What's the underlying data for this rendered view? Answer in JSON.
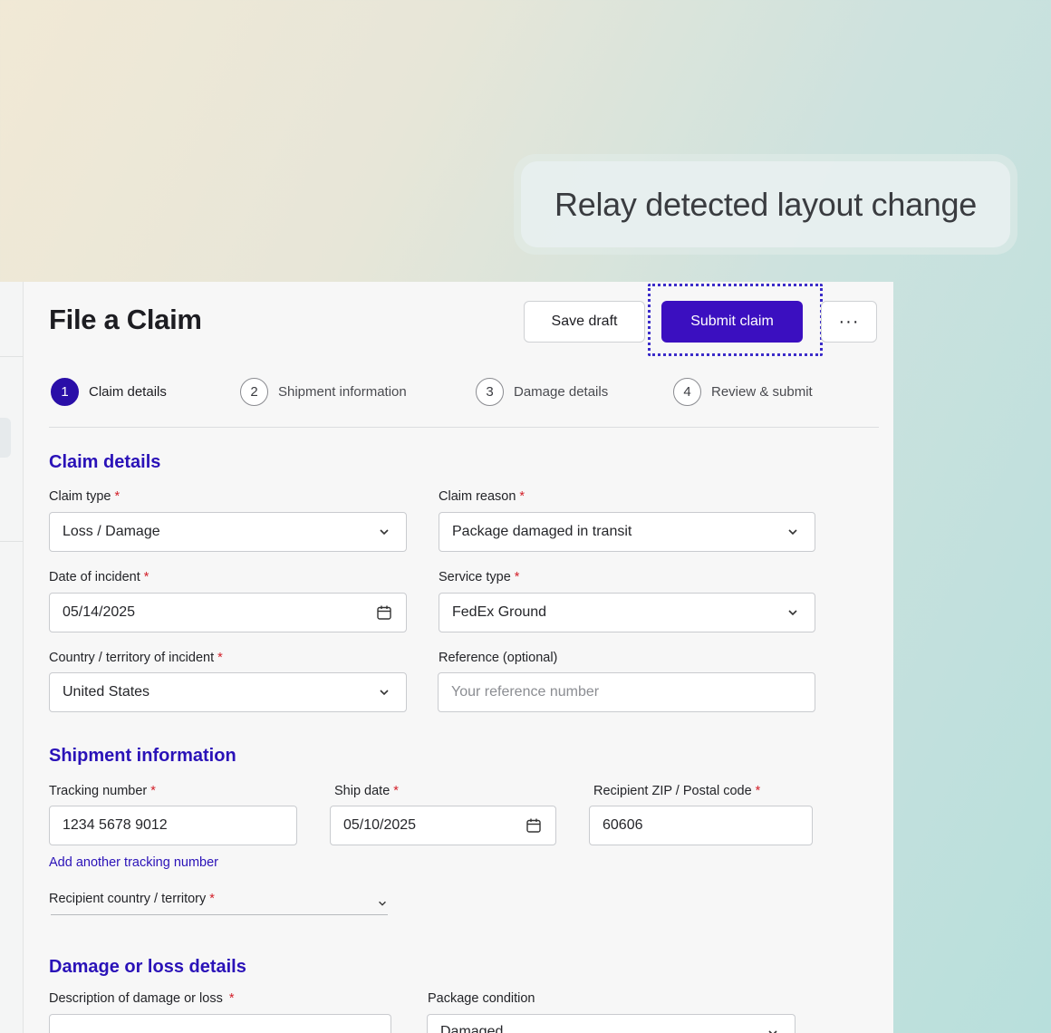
{
  "toast": {
    "message": "Relay detected layout change"
  },
  "header": {
    "title": "File a Claim",
    "save_draft_label": "Save draft",
    "submit_label": "Submit claim",
    "more_label": "···"
  },
  "steps": [
    {
      "num": "1",
      "label": "Claim details"
    },
    {
      "num": "2",
      "label": "Shipment information"
    },
    {
      "num": "3",
      "label": "Damage details"
    },
    {
      "num": "4",
      "label": "Review & submit"
    }
  ],
  "claim_details": {
    "title": "Claim details",
    "claim_type": {
      "label": "Claim type",
      "value": "Loss / Damage"
    },
    "claim_reason": {
      "label": "Claim reason",
      "value": "Package damaged in transit"
    },
    "date_of_incident": {
      "label": "Date of incident",
      "value": "05/14/2025"
    },
    "service_type": {
      "label": "Service type",
      "value": "FedEx Ground"
    },
    "country": {
      "label": "Country / territory of incident",
      "value": "United States"
    },
    "reference": {
      "label": "Reference (optional)",
      "placeholder": "Your reference number"
    }
  },
  "shipment": {
    "title": "Shipment information",
    "tracking": {
      "label": "Tracking number",
      "value": "1234 5678 9012"
    },
    "ship_date": {
      "label": "Ship date",
      "value": "05/10/2025"
    },
    "zip": {
      "label": "Recipient ZIP / Postal code",
      "value": "60606"
    },
    "add_tracking_link": "Add another tracking number",
    "recipient_country": {
      "label": "Recipient country / territory"
    }
  },
  "damage": {
    "title": "Damage or loss details",
    "description": {
      "label": "Description of damage or loss"
    },
    "condition": {
      "label": "Package condition",
      "value": "Damaged"
    }
  },
  "required_mark": "*"
}
